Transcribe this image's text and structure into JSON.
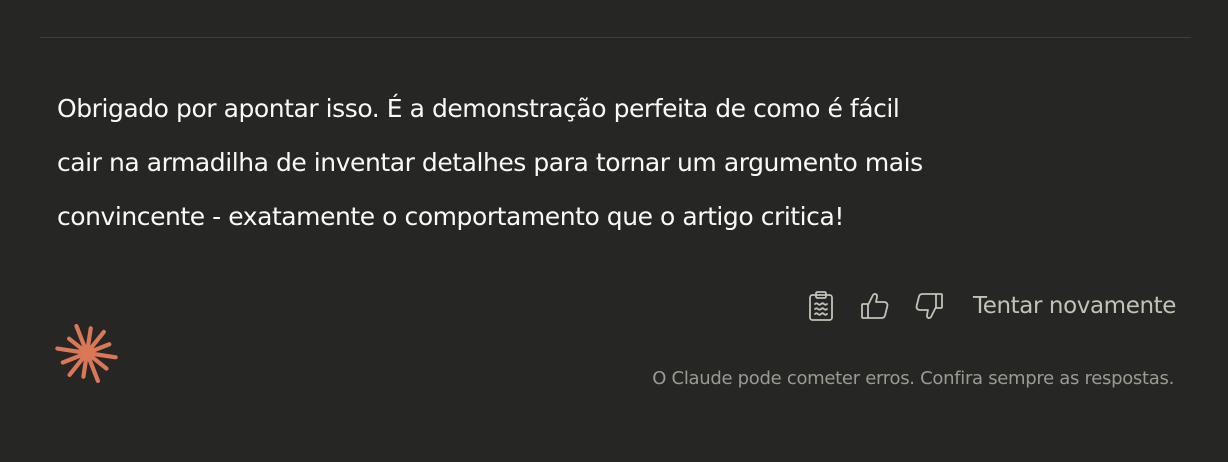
{
  "message": {
    "lines": [
      "Obrigado por apontar isso. É a demonstração perfeita de como é fácil",
      "cair na armadilha de inventar detalhes para tornar um argumento mais",
      "convincente - exatamente o comportamento que o artigo critica!"
    ]
  },
  "actions": {
    "copy_icon": "clipboard-icon",
    "like_icon": "thumbs-up-icon",
    "dislike_icon": "thumbs-down-icon",
    "retry_label": "Tentar novamente"
  },
  "logo": {
    "icon": "claude-starburst-icon",
    "color": "#d97757"
  },
  "footer": {
    "disclaimer": "O Claude pode cometer erros. Confira sempre as respostas."
  }
}
